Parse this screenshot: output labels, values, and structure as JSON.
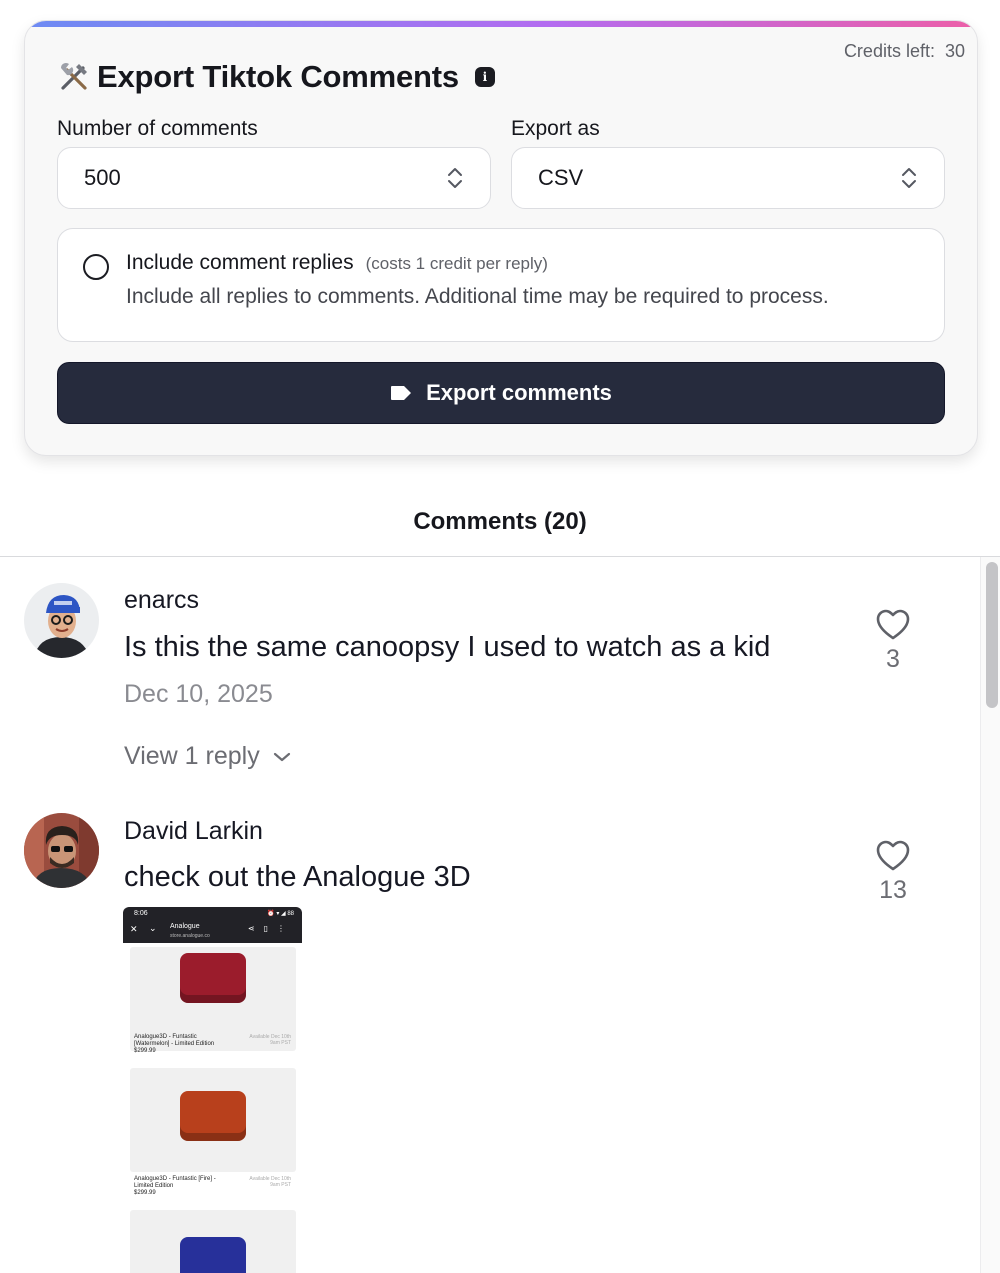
{
  "export_card": {
    "credits_label": "Credits left:",
    "credits_value": "30",
    "title": "Export Tiktok Comments",
    "info_glyph": "i",
    "number_label": "Number of comments",
    "number_value": "500",
    "format_label": "Export as",
    "format_value": "CSV",
    "replies_title": "Include comment replies",
    "replies_cost": "(costs 1 credit per reply)",
    "replies_desc": "Include all replies to comments. Additional time may be required to process.",
    "replies_checked": false,
    "export_button": "Export comments",
    "gradient_colors": [
      "#6d8bf3",
      "#b36cf0",
      "#ec5fa8"
    ],
    "button_color": "#262b3d"
  },
  "comments": {
    "header": "Comments (20)",
    "items": [
      {
        "user": "enarcs",
        "text": "Is this the same canoopsy I used to watch as a kid",
        "date": "Dec 10, 2025",
        "likes": "3",
        "view_replies": "View 1 reply"
      },
      {
        "user": "David Larkin",
        "text": "check out the Analogue 3D",
        "likes": "13",
        "image": {
          "time": "8:06",
          "status": "⏰ ▾ ◢ 88",
          "site": "Analogue",
          "url": "store.analogue.co",
          "products": [
            {
              "name": "Analogue3D - Funtastic [Watermelon] - Limited Edition",
              "price": "$299.99",
              "availability": "Available Dec 10th 9am PST",
              "color": "#9b1c2c"
            },
            {
              "name": "Analogue3D - Funtastic [Fire] - Limited Edition",
              "price": "$299.99",
              "availability": "Available Dec 10th 9am PST",
              "color": "#b8401c"
            },
            {
              "name": "",
              "price": "",
              "availability": "",
              "color": "#27309a"
            }
          ]
        }
      }
    ]
  }
}
